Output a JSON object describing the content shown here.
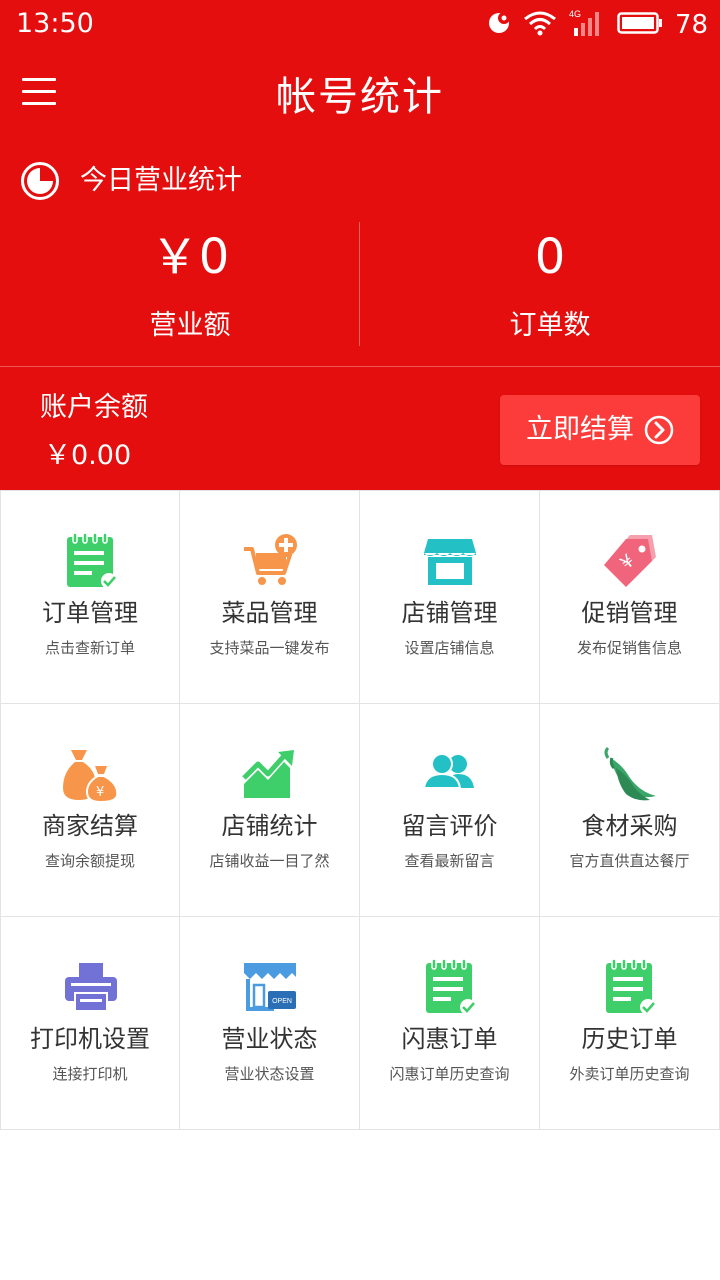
{
  "status_bar": {
    "time": "13:50",
    "battery": "78",
    "network": "4G"
  },
  "header": {
    "title": "帐号统计"
  },
  "today": {
    "label": "今日营业统计",
    "revenue_value": "￥0",
    "revenue_label": "营业额",
    "orders_value": "0",
    "orders_label": "订单数"
  },
  "balance": {
    "label": "账户余额",
    "value": "￥0.00",
    "settle_button": "立即结算"
  },
  "colors": {
    "primary": "#e50e0f",
    "button": "#fb3c3b",
    "green": "#3ecf6a",
    "orange": "#f7964a",
    "teal": "#23c1c6",
    "pink": "#f0657c",
    "purple": "#7271d6",
    "blue": "#4a9be0"
  },
  "grid": [
    {
      "title": "订单管理",
      "subtitle": "点击查新订单",
      "icon": "order-list-icon"
    },
    {
      "title": "菜品管理",
      "subtitle": "支持菜品一键发布",
      "icon": "cart-add-icon"
    },
    {
      "title": "店铺管理",
      "subtitle": "设置店铺信息",
      "icon": "storefront-icon"
    },
    {
      "title": "促销管理",
      "subtitle": "发布促销售信息",
      "icon": "price-tag-icon"
    },
    {
      "title": "商家结算",
      "subtitle": "查询余额提现",
      "icon": "money-bag-icon"
    },
    {
      "title": "店铺统计",
      "subtitle": "店铺收益一目了然",
      "icon": "trend-chart-icon"
    },
    {
      "title": "留言评价",
      "subtitle": "查看最新留言",
      "icon": "users-icon"
    },
    {
      "title": "食材采购",
      "subtitle": "官方直供直达餐厅",
      "icon": "chili-pepper-icon"
    },
    {
      "title": "打印机设置",
      "subtitle": "连接打印机",
      "icon": "printer-icon"
    },
    {
      "title": "营业状态",
      "subtitle": "营业状态设置",
      "icon": "shop-open-icon"
    },
    {
      "title": "闪惠订单",
      "subtitle": "闪惠订单历史查询",
      "icon": "order-list-icon"
    },
    {
      "title": "历史订单",
      "subtitle": "外卖订单历史查询",
      "icon": "order-list-icon"
    }
  ]
}
